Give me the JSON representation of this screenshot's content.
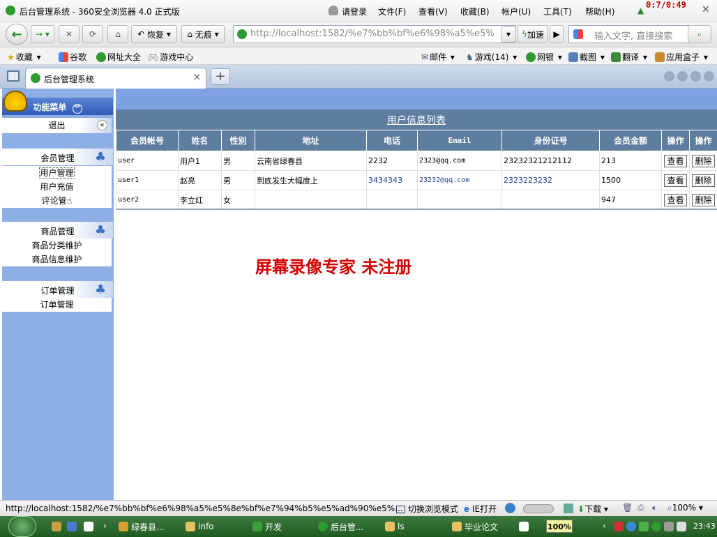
{
  "window": {
    "title": "后台管理系统 - 360安全浏览器 4.0 正式版",
    "menu": [
      "请登录",
      "文件(F)",
      "查看(V)",
      "收藏(B)",
      "帐户(U)",
      "工具(T)",
      "帮助(H)"
    ],
    "recorder": "0:7/0:49"
  },
  "navbar": {
    "restore_label": "恢复",
    "notrace_label": "无痕",
    "url": "http://localhost:1582/%e7%bb%bf%e6%98%a5%e5%",
    "speedup_label": "加速",
    "search_placeholder": "输入文字, 直接搜索"
  },
  "favbar": {
    "left": [
      "收藏",
      "谷歌",
      "网址大全",
      "游戏中心"
    ],
    "right": [
      "邮件",
      "游戏(14)",
      "网银",
      "截图",
      "翻译",
      "应用盒子"
    ]
  },
  "tab": {
    "title": "后台管理系统"
  },
  "sidebar": {
    "title": "功能菜单",
    "logout": "退出",
    "sections": [
      {
        "title": "会员管理",
        "items": [
          "用户管理",
          "用户充值",
          "评论管"
        ]
      },
      {
        "title": "商品管理",
        "items": [
          "商品分类维护",
          "商品信息维护"
        ]
      },
      {
        "title": "订单管理",
        "items": [
          "订单管理"
        ]
      }
    ]
  },
  "main": {
    "list_title": "用户信息列表",
    "columns": [
      "会员帐号",
      "姓名",
      "性别",
      "地址",
      "电话",
      "Email",
      "身份证号",
      "会员金额",
      "操作",
      "操作"
    ],
    "view_label": "查看",
    "delete_label": "删除",
    "rows": [
      {
        "account": "user",
        "name": "用户1",
        "gender": "男",
        "address": "云南省绿春县",
        "phone": "2232",
        "email": "2323@qq.com",
        "idcard": "23232321212112",
        "amount": "213"
      },
      {
        "account": "user1",
        "name": "赵亮",
        "gender": "男",
        "address": "到底发生大幅度上",
        "phone": "3434343",
        "email": "23232@qq.com",
        "idcard": "2323223232",
        "amount": "1500"
      },
      {
        "account": "user2",
        "name": "李立红",
        "gender": "女",
        "address": "",
        "phone": "",
        "email": "",
        "idcard": "",
        "amount": "947"
      }
    ],
    "watermark": "屏幕录像专家  未注册"
  },
  "statusbar": {
    "url": "http://localhost:1582/%e7%bb%bf%e6%98%a5%e5%8e%bf%e7%94%b5%e5%ad%90%e5%...",
    "switch_mode": "切换浏览模式",
    "ie_open": "IE打开",
    "download": "下载",
    "zoom": "100%"
  },
  "taskbar": {
    "items": [
      "绿春县...",
      "info",
      "开发",
      "后台管...",
      "ls",
      "毕业论文"
    ],
    "badge": "100%",
    "clock": "23:43"
  }
}
